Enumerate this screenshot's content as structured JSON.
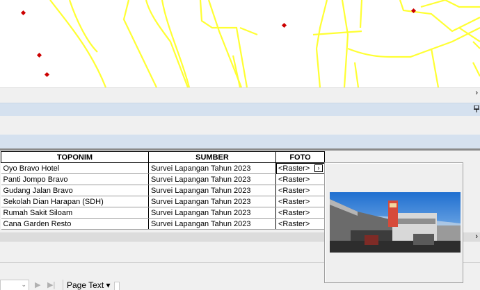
{
  "table": {
    "columns": [
      "TOPONIM",
      "SUMBER",
      "FOTO"
    ],
    "rows": [
      [
        "Oyo Bravo Hotel",
        "Survei Lapangan Tahun 2023",
        "<Raster>"
      ],
      [
        "Panti Jompo Bravo",
        "Survei Lapangan Tahun 2023",
        "<Raster>"
      ],
      [
        "Gudang Jalan Bravo",
        "Survei Lapangan Tahun 2023",
        "<Raster>"
      ],
      [
        "Sekolah Dian Harapan (SDH)",
        "Survei Lapangan Tahun 2023",
        "<Raster>"
      ],
      [
        "Rumah Sakit Siloam",
        "Survei Lapangan Tahun 2023",
        "<Raster>"
      ],
      [
        "Cana Garden Resto",
        "Survei Lapangan Tahun 2023",
        "<Raster>"
      ]
    ],
    "selected_row": 0,
    "cell_button_glyph": "›"
  },
  "statusbar": {
    "page_text_label": "Page Text ▾",
    "next_glyph": "▶",
    "last_glyph": "▶|"
  },
  "scroll_arrow": "›",
  "icons": {
    "pin": "pin-icon",
    "map_point": "point-marker",
    "combo": "chevron-down-icon"
  },
  "colors": {
    "road": "#ffff33",
    "point": "#cc0000",
    "header_band": "#d5e1ef"
  }
}
